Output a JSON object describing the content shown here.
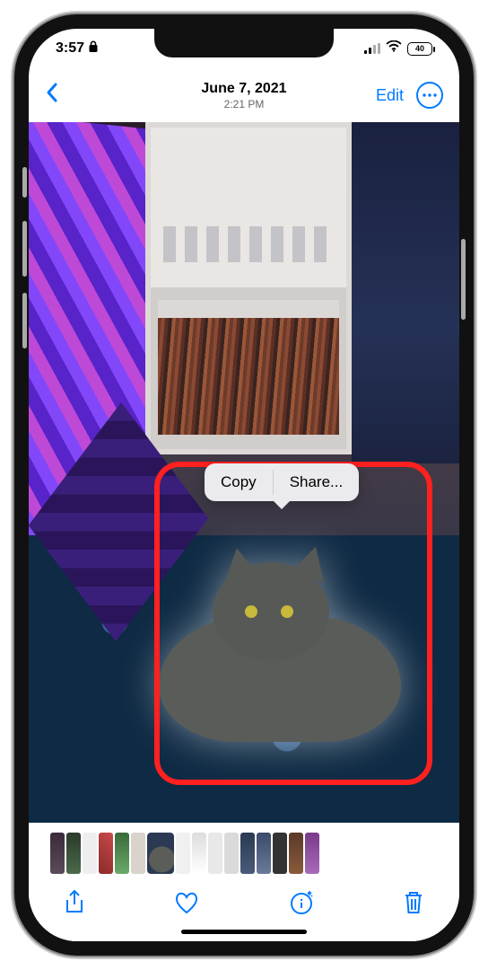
{
  "status": {
    "time": "3:57",
    "battery": "40"
  },
  "nav": {
    "date": "June 7, 2021",
    "time": "2:21 PM",
    "edit": "Edit"
  },
  "popup": {
    "copy": "Copy",
    "share": "Share..."
  }
}
